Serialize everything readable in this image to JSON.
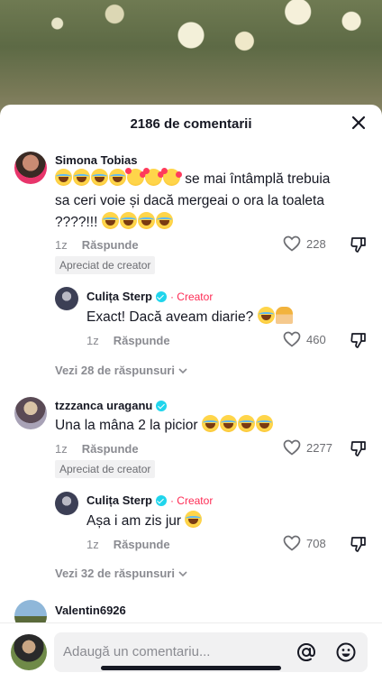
{
  "header": {
    "title": "2186 de comentarii"
  },
  "comments": [
    {
      "author": "Simona Tobias",
      "text_suffix": " se mai întâmplă trebuia sa ceri voie și dacă mergeai o ora la toaleta ????!!!",
      "age": "1z",
      "reply_label": "Răspunde",
      "likes": "228",
      "badge": "Apreciat de creator",
      "reply": {
        "author": "Culița Sterp",
        "role": "· Creator",
        "text": "Exact! Dacă aveam diarie?",
        "age": "1z",
        "reply_label": "Răspunde",
        "likes": "460"
      },
      "view_replies": "Vezi 28 de răspunsuri"
    },
    {
      "author": "tzzzanca uraganu",
      "text": "Una la mâna 2 la picior",
      "age": "1z",
      "reply_label": "Răspunde",
      "likes": "2277",
      "badge": "Apreciat de creator",
      "reply": {
        "author": "Culița Sterp",
        "role": "· Creator",
        "text": "Așa i am zis jur",
        "age": "1z",
        "reply_label": "Răspunde",
        "likes": "708"
      },
      "view_replies": "Vezi 32 de răspunsuri"
    },
    {
      "author": "Valentin6926"
    }
  ],
  "input": {
    "placeholder": "Adaugă un comentariu..."
  },
  "colors": {
    "creator": "#fe2c55",
    "verified": "#20d5ec",
    "muted": "#8a8b91"
  },
  "icons": [
    "close-icon",
    "heart-icon",
    "dislike-icon",
    "chevron-down-icon",
    "at-icon",
    "emoji-icon",
    "verified-icon"
  ]
}
